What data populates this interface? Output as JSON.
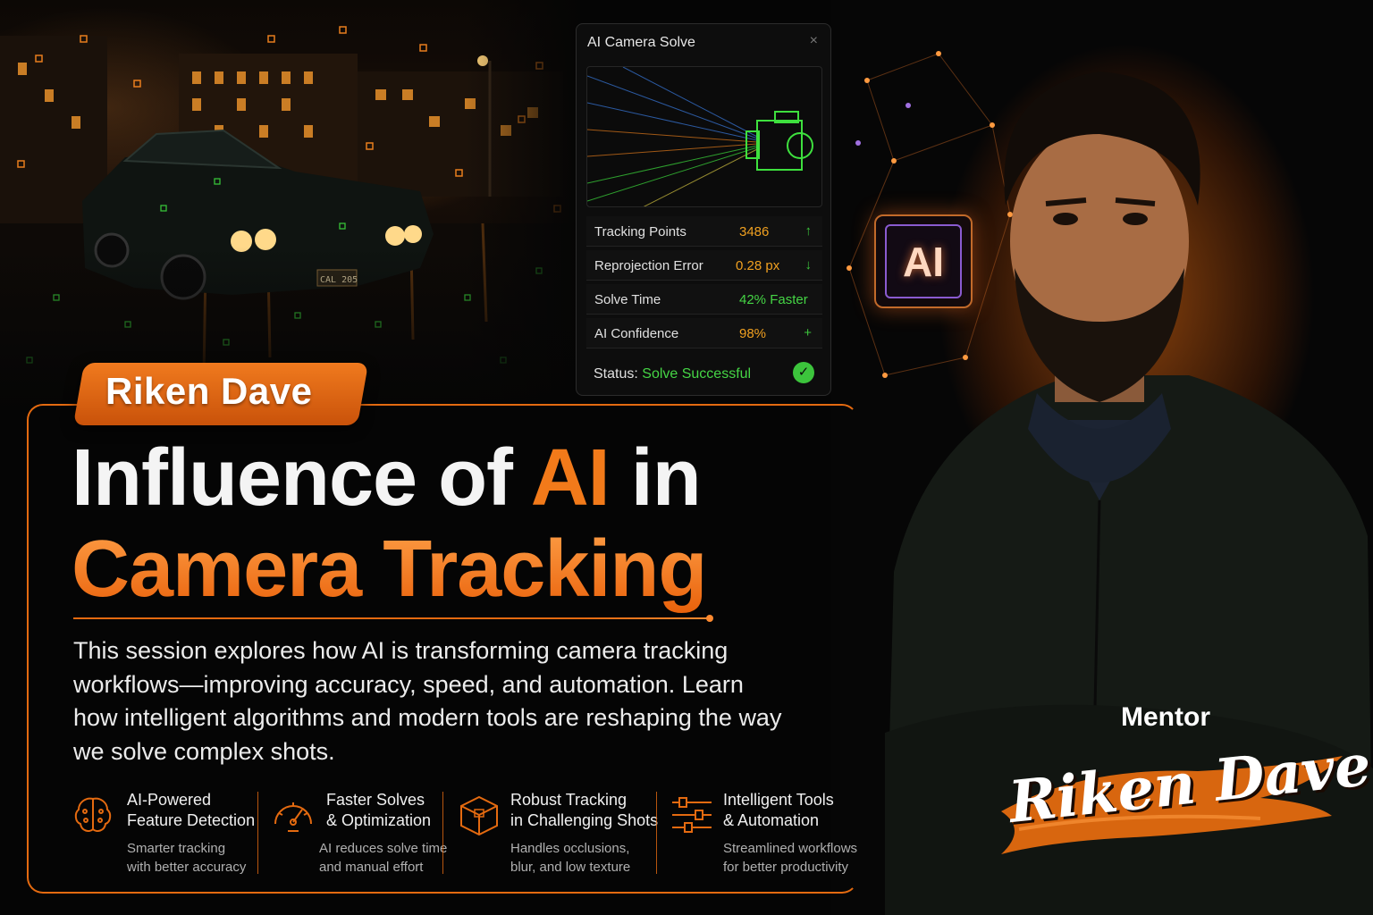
{
  "panel": {
    "title": "AI Camera Solve",
    "close_glyph": "×",
    "stats": [
      {
        "label": "Tracking Points",
        "value": "3486",
        "trend": "↑",
        "value_color": "#f0a020"
      },
      {
        "label": "Reprojection Error",
        "value": "0.28 px",
        "trend": "↓",
        "value_color": "#f0a020"
      },
      {
        "label": "Solve Time",
        "value": "42% Faster",
        "trend": "",
        "value_color": "#45d545"
      },
      {
        "label": "AI Confidence",
        "value": "98%",
        "trend": "+",
        "value_color": "#f0a020"
      }
    ],
    "status_label": "Status:",
    "status_value": "Solve Successful",
    "status_icon": "check-circle-icon"
  },
  "chip": {
    "label": "AI"
  },
  "presenter_tag": "Riken Dave",
  "headline": {
    "line1_before": "Influence of ",
    "line1_highlight": "AI",
    "line1_after": " in",
    "line2": "Camera Tracking"
  },
  "description": "This session explores how AI is transforming camera tracking workflows—improving accuracy, speed, and automation. Learn how intelligent algorithms and modern tools are reshaping the way we solve complex shots.",
  "features": [
    {
      "icon": "brain-icon",
      "title_1": "AI-Powered",
      "title_2": "Feature Detection",
      "desc_1": "Smarter tracking",
      "desc_2": "with better accuracy"
    },
    {
      "icon": "speedometer-icon",
      "title_1": "Faster Solves",
      "title_2": "& Optimization",
      "desc_1": "AI reduces solve time",
      "desc_2": "and manual effort"
    },
    {
      "icon": "cube-icon",
      "title_1": "Robust Tracking",
      "title_2": "in Challenging Shots",
      "desc_1": "Handles occlusions,",
      "desc_2": "blur, and low texture"
    },
    {
      "icon": "sliders-icon",
      "title_1": "Intelligent Tools",
      "title_2": "& Automation",
      "desc_1": "Streamlined workflows",
      "desc_2": "for better productivity"
    }
  ],
  "mentor": {
    "label": "Mentor",
    "name": "Riken Dave"
  },
  "colors": {
    "accent": "#e46a10",
    "success": "#45d545",
    "value": "#f0a020"
  }
}
